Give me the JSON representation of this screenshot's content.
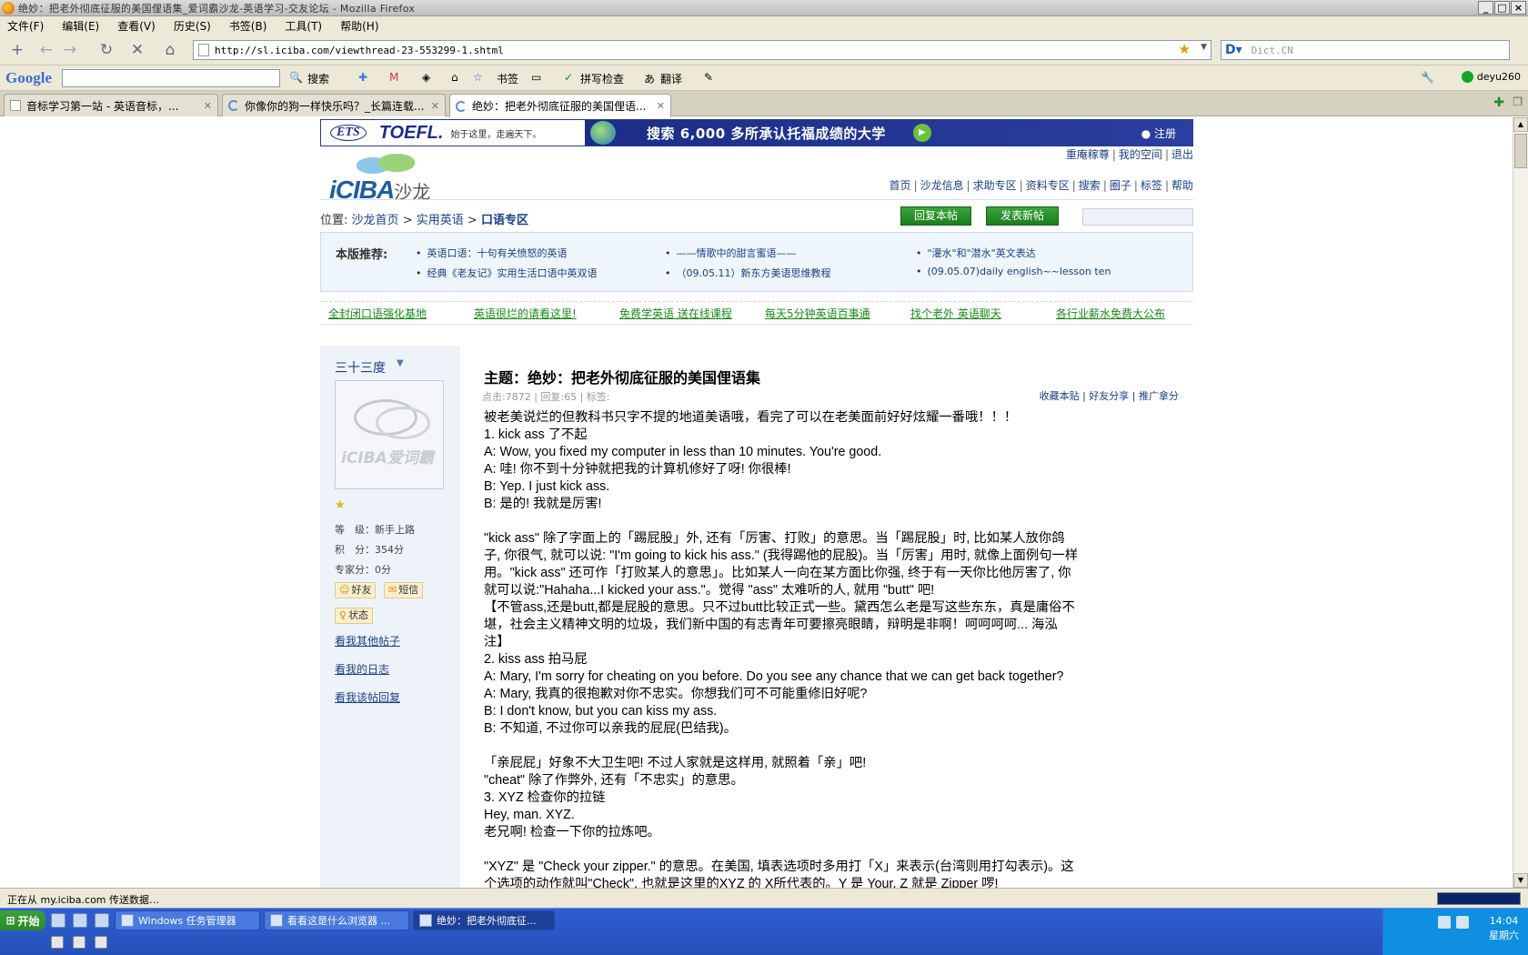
{
  "window": {
    "title": "绝妙：把老外彻底征服的美国俚语集_爱词霸沙龙-英语学习-交友论坛 - Mozilla Firefox"
  },
  "menu": [
    "文件(F)",
    "编辑(E)",
    "查看(V)",
    "历史(S)",
    "书签(B)",
    "工具(T)",
    "帮助(H)"
  ],
  "nav": {
    "url": "http://sl.iciba.com/viewthread-23-553299-1.shtml",
    "search_placeholder": "Dict.CN"
  },
  "googlebar": {
    "logo": "Google",
    "search": "搜索",
    "bookmarks": "书签",
    "spell": "拼写检查",
    "translate": "翻译",
    "user": "deyu260"
  },
  "tabs": [
    {
      "label": "音标学习第一站 - 英语音标，..."
    },
    {
      "label": "你像你的狗一样快乐吗？_长篇连载..."
    },
    {
      "label": "绝妙：把老外彻底征服的美国俚语..."
    }
  ],
  "banner": {
    "brand": "TOEFL.",
    "ets": "ETS",
    "slogan": "始于这里，走遍天下。",
    "text": "搜索 6,000 多所承认托福成绩的大学",
    "register": "● 注册"
  },
  "site": {
    "logo_text": "iCIBA",
    "logo_suffix": "沙龙",
    "toplinks": [
      "重庵稼尊",
      "我的空间",
      "退出"
    ],
    "mainnav": [
      "首页",
      "沙龙信息",
      "求助专区",
      "资料专区",
      "搜索",
      "圈子",
      "标签",
      "帮助"
    ],
    "crumbs": {
      "prefix": "位置:",
      "home": "沙龙首页",
      "sec": "实用英语",
      "current": "口语专区",
      "arrow": ">"
    },
    "reply_btn": "回复本帖",
    "new_btn": "发表新帖"
  },
  "recommend": {
    "title": "本版推荐:",
    "items": [
      "英语口语：十句有关愤怒的英语",
      "——情歌中的甜言蜜语——",
      "\"灌水\"和\"潜水\"英文表达",
      "经典《老友记》实用生活口语中英双语",
      "（09.05.11）新东方美语思维教程",
      "(09.05.07)daily english~~lesson ten"
    ]
  },
  "adlinks": [
    "全封闭口语强化基地",
    "英语很烂的请看这里!",
    "免费学英语 送在线课程",
    "每天5分钟英语百事通",
    "找个老外 英语聊天",
    "各行业薪水免费大公布"
  ],
  "user": {
    "name": "三十三度",
    "avatar_text": "iCIBA爱词霸",
    "level": "等　级：新手上路",
    "points": "积　分：354分",
    "expert": "专家分：0分",
    "friend_btn": "好友",
    "msg_btn": "短信",
    "status_btn": "状态",
    "links": [
      "看我其他帖子",
      "看我的日志",
      "看我该帖回复"
    ]
  },
  "post": {
    "title": "主题：绝妙：把老外彻底征服的美国俚语集",
    "meta": "点击:7872 | 回复:65 | 标签:",
    "actions": "收藏本贴 | 好友分享 | 推广拿分",
    "body": "被老美说烂的但教科书只字不提的地道美语哦，看完了可以在老美面前好好炫耀一番哦！！！\n1. kick ass 了不起\nA: Wow, you fixed my computer in less than 10 minutes. You're good.\nA: 哇! 你不到十分钟就把我的计算机修好了呀! 你很棒!\nB: Yep. I just kick ass.\nB: 是的! 我就是厉害!\n\n\"kick ass\" 除了字面上的「踢屁股」外, 还有「厉害、打败」的意思。当「踢屁股」时, 比如某人放你鸽\n子, 你很气, 就可以说: \"I'm going to kick his ass.\" (我得踢他的屁股)。当「厉害」用时, 就像上面例句一样\n用。\"kick ass\" 还可作「打败某人的意思」。比如某人一向在某方面比你强, 终于有一天你比他厉害了, 你\n就可以说:\"Hahaha...I kicked your ass.\"。觉得 \"ass\" 太难听的人, 就用 \"butt\" 吧!\n【不管ass,还是butt,都是屁股的意思。只不过butt比较正式一些。黛西怎么老是写这些东东，真是庸俗不\n堪，社会主义精神文明的垃圾，我们新中国的有志青年可要擦亮眼睛，辩明是非啊！呵呵呵呵... 海泓\n注】\n2. kiss ass 拍马屁\nA: Mary, I'm sorry for cheating on you before. Do you see any chance that we can get back together?\nA: Mary, 我真的很抱歉对你不忠实。你想我们可不可能重修旧好呢?\nB: I don't know, but you can kiss my ass.\nB: 不知道, 不过你可以亲我的屁屁(巴结我)。\n\n「亲屁屁」好象不大卫生吧! 不过人家就是这样用, 就照着「亲」吧!\n\"cheat\" 除了作弊外, 还有「不忠实」的意思。\n3. XYZ 检查你的拉链\nHey, man. XYZ.\n老兄啊! 检查一下你的拉炼吧。\n\n\"XYZ\" 是 \"Check your zipper.\" 的意思。在美国, 填表选项时多用打「X」来表示(台湾则用打勾表示)。这\n个选项的动作就叫\"Check\", 也就是这里的XYZ 的 X所代表的。Y 是 Your, Z 就是 Zipper 啰!"
  },
  "status": {
    "text": "正在从 my.iciba.com 传送数据…"
  },
  "taskbar": {
    "start": "开始",
    "tasks": [
      "Windows 任务管理器",
      "看看这是什么浏览器 ...",
      "绝妙：把老外彻底征..."
    ],
    "time": "14:04",
    "day": "星期六"
  }
}
